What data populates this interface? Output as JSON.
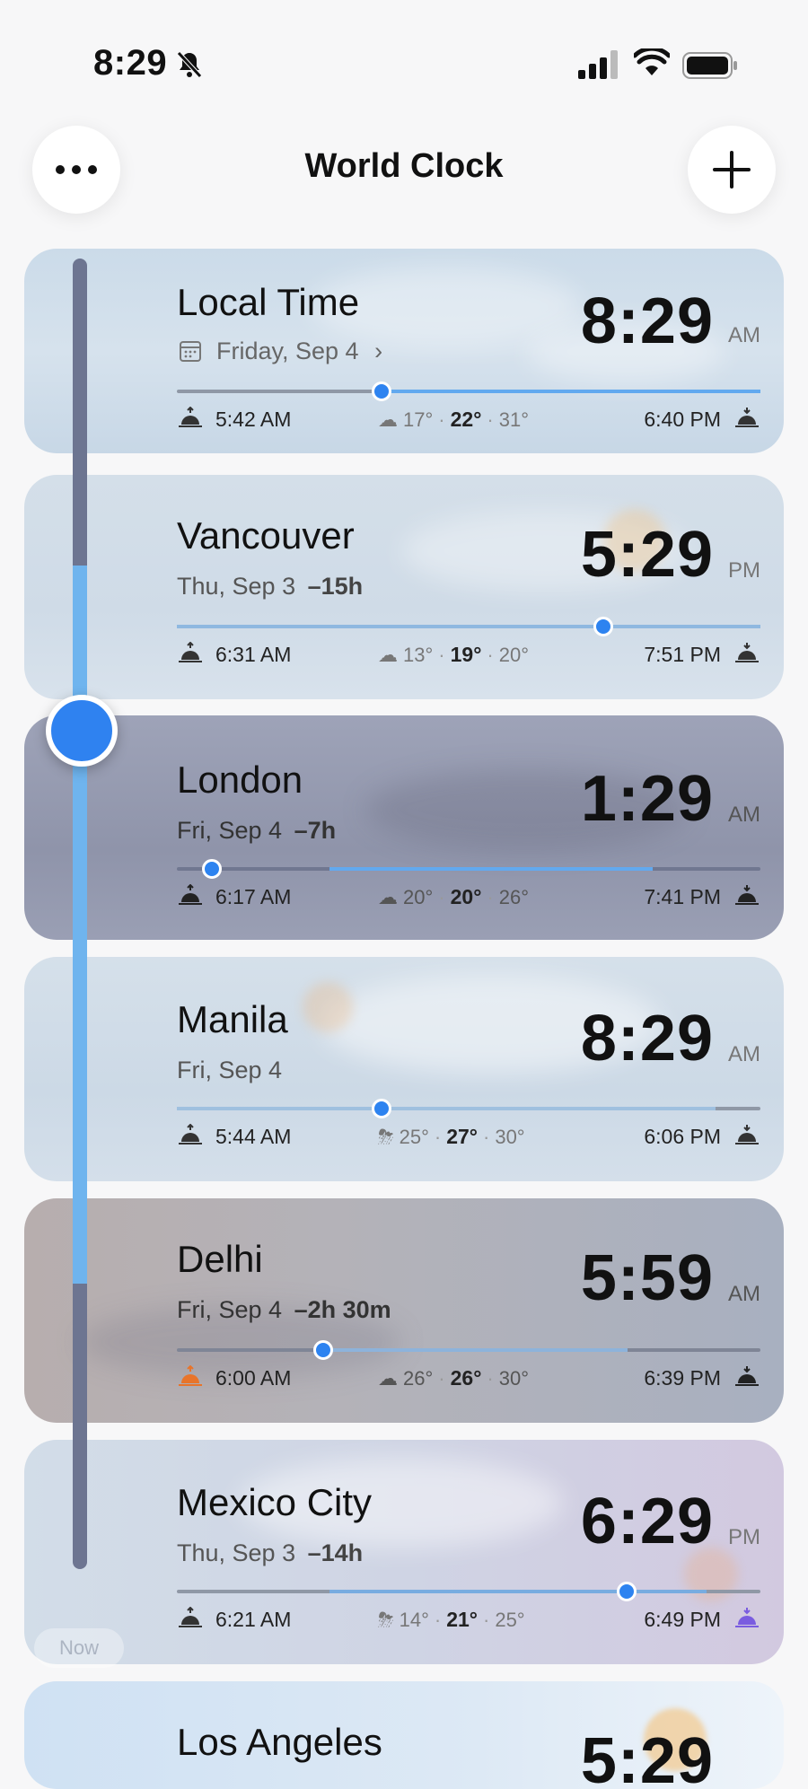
{
  "status_bar": {
    "time": "8:29"
  },
  "header": {
    "title": "World Clock"
  },
  "now_label": "Now",
  "cards": [
    {
      "city": "Local Time",
      "date": "Friday, Sep 4",
      "offset": "",
      "time": "8:29",
      "ampm": "AM",
      "sunrise": "5:42 AM",
      "sunset": "6:40 PM",
      "low": "17°",
      "current": "22°",
      "high": "31°",
      "weather": "cloud-icon",
      "day_progress": 0.35
    },
    {
      "city": "Vancouver",
      "date": "Thu, Sep 3",
      "offset": "–15h",
      "time": "5:29",
      "ampm": "PM",
      "sunrise": "6:31 AM",
      "sunset": "7:51 PM",
      "low": "13°",
      "current": "19°",
      "high": "20°",
      "weather": "cloud-icon",
      "day_progress": 0.73
    },
    {
      "city": "London",
      "date": "Fri, Sep 4",
      "offset": "–7h",
      "time": "1:29",
      "ampm": "AM",
      "sunrise": "6:17 AM",
      "sunset": "7:41 PM",
      "low": "20°",
      "current": "20°",
      "high": "26°",
      "weather": "cloud-icon",
      "day_progress": 0.06
    },
    {
      "city": "Manila",
      "date": "Fri, Sep 4",
      "offset": "",
      "time": "8:29",
      "ampm": "AM",
      "sunrise": "5:44 AM",
      "sunset": "6:06 PM",
      "low": "25°",
      "current": "27°",
      "high": "30°",
      "weather": "thunderstorm-icon",
      "day_progress": 0.35
    },
    {
      "city": "Delhi",
      "date": "Fri, Sep 4",
      "offset": "–2h 30m",
      "time": "5:59",
      "ampm": "AM",
      "sunrise": "6:00 AM",
      "sunset": "6:39 PM",
      "low": "26°",
      "current": "26°",
      "high": "30°",
      "weather": "cloud-icon",
      "day_progress": 0.25
    },
    {
      "city": "Mexico City",
      "date": "Thu, Sep 3",
      "offset": "–14h",
      "time": "6:29",
      "ampm": "PM",
      "sunrise": "6:21 AM",
      "sunset": "6:49 PM",
      "low": "14°",
      "current": "21°",
      "high": "25°",
      "weather": "thunderstorm-icon",
      "day_progress": 0.77
    },
    {
      "city": "Los Angeles",
      "time": "5:29"
    }
  ],
  "colors": {
    "accent": "#2f82f0",
    "rail": "#6d7591",
    "rail_lit": "#6fb4ee"
  }
}
